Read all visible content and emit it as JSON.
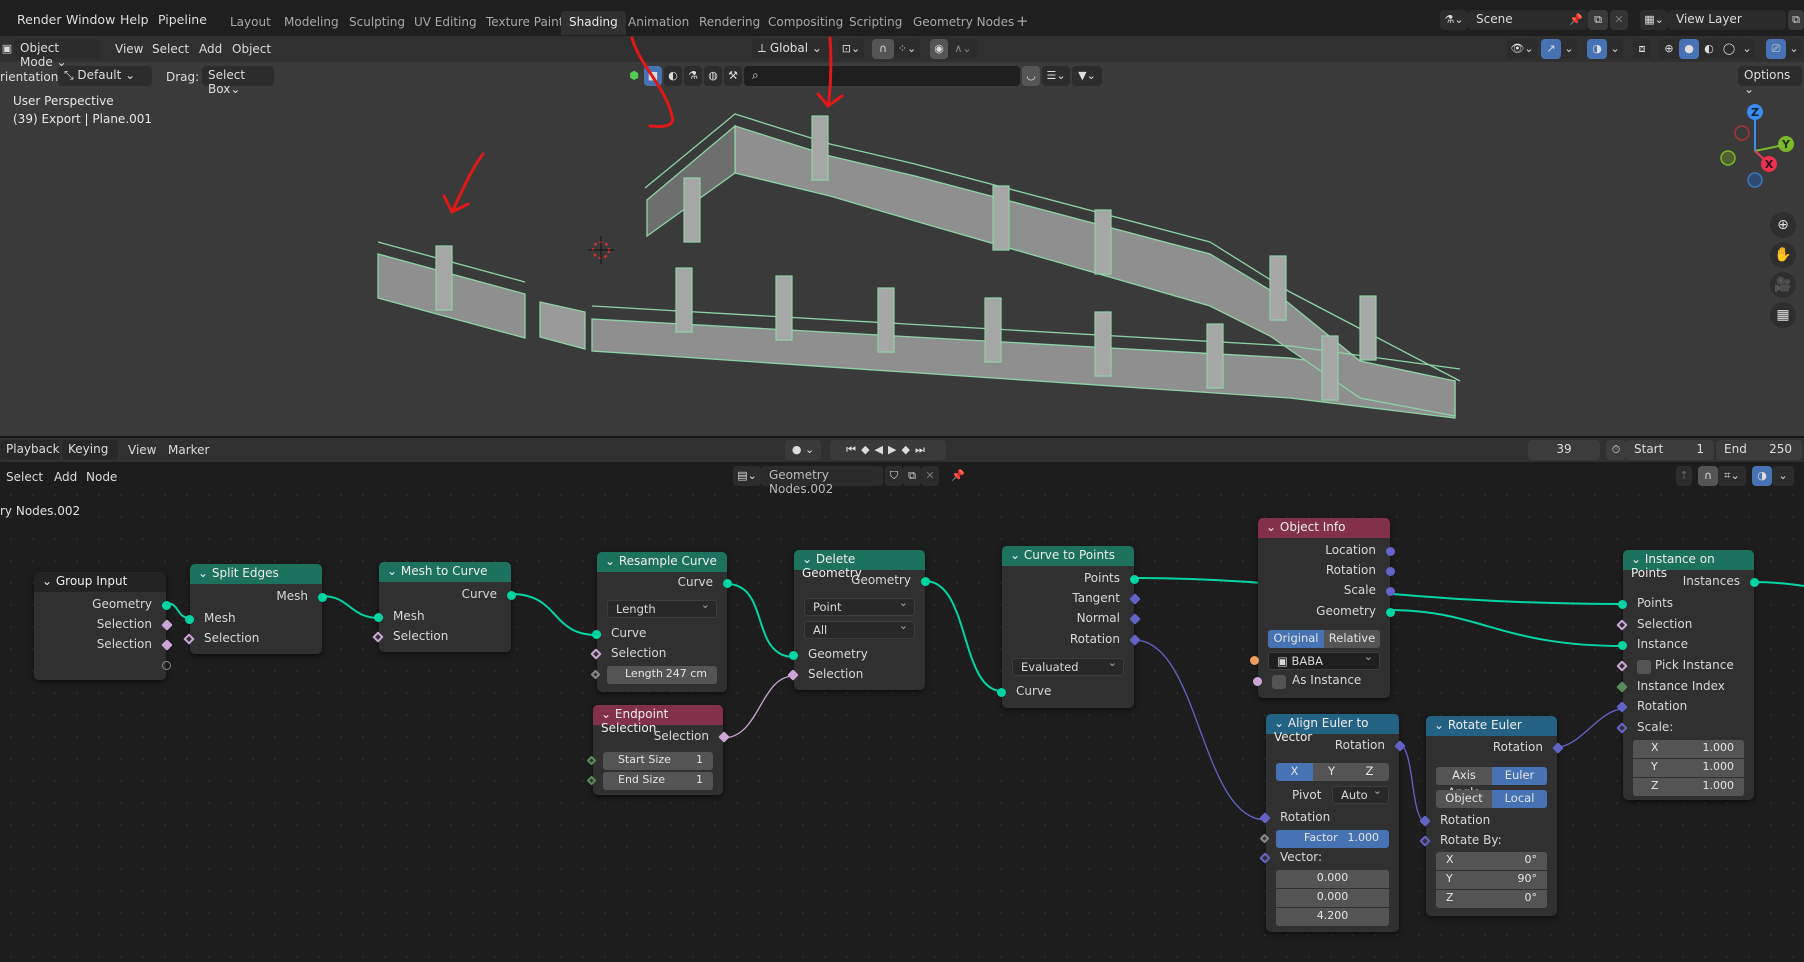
{
  "menubar": {
    "menus": [
      "Render",
      "Window",
      "Help",
      "Pipeline"
    ],
    "workspaces": [
      "Layout",
      "Modeling",
      "Sculpting",
      "UV Editing",
      "Texture Paint",
      "Shading",
      "Animation",
      "Rendering",
      "Compositing",
      "Scripting",
      "Geometry Nodes"
    ],
    "active_workspace": "Shading",
    "add_workspace": "+",
    "scene": "Scene",
    "view_layer": "View Layer"
  },
  "viewport_header": {
    "mode": "Object Mode",
    "menus": [
      "View",
      "Select",
      "Add",
      "Object"
    ],
    "transform_orientation": "Global",
    "orientation_label": "rientation:",
    "orientation_value": "Default",
    "drag_label": "Drag:",
    "drag_value": "Select Box",
    "options": "Options"
  },
  "viewport": {
    "view_name": "User Perspective",
    "object_info": "(39) Export | Plane.001",
    "gizmo_axes": [
      "Z",
      "Y",
      "X"
    ]
  },
  "timeline": {
    "menus": [
      "Playback",
      "Keying",
      "View",
      "Marker"
    ],
    "current_frame": "39",
    "start_label": "Start",
    "start": "1",
    "end_label": "End",
    "end": "250"
  },
  "node_editor": {
    "menus": [
      "Select",
      "Add",
      "Node"
    ],
    "node_tree": "Geometry Nodes.002",
    "breadcrumb": "ry Nodes.002",
    "nodes": {
      "group_input": {
        "title": "Group Input",
        "outputs": [
          "Geometry",
          "Selection",
          "Selection"
        ]
      },
      "split_edges": {
        "title": "Split Edges",
        "output": "Mesh",
        "inputs": [
          "Mesh",
          "Selection"
        ]
      },
      "mesh_to_curve": {
        "title": "Mesh to Curve",
        "output": "Curve",
        "inputs": [
          "Mesh",
          "Selection"
        ]
      },
      "resample_curve": {
        "title": "Resample Curve",
        "output": "Curve",
        "mode": "Length",
        "inputs": [
          "Curve",
          "Selection"
        ],
        "length_label": "Length",
        "length_value": "247 cm"
      },
      "endpoint_selection": {
        "title": "Endpoint Selection",
        "output": "Selection",
        "start_label": "Start Size",
        "start_value": "1",
        "end_label": "End Size",
        "end_value": "1"
      },
      "delete_geometry": {
        "title": "Delete Geometry",
        "output": "Geometry",
        "domain": "Point",
        "mode": "All",
        "inputs": [
          "Geometry",
          "Selection"
        ]
      },
      "curve_to_points": {
        "title": "Curve to Points",
        "outputs": [
          "Points",
          "Tangent",
          "Normal",
          "Rotation"
        ],
        "mode": "Evaluated",
        "input": "Curve"
      },
      "object_info": {
        "title": "Object Info",
        "outputs": [
          "Location",
          "Rotation",
          "Scale",
          "Geometry"
        ],
        "toggle": [
          "Original",
          "Relative"
        ],
        "active_toggle": "Original",
        "object": "BABA",
        "as_instance": "As Instance"
      },
      "align_euler": {
        "title": "Align Euler to Vector",
        "output": "Rotation",
        "axes": [
          "X",
          "Y",
          "Z"
        ],
        "active_axis": "X",
        "pivot_label": "Pivot",
        "pivot_value": "Auto",
        "rotation_label": "Rotation",
        "factor_label": "Factor",
        "factor_value": "1.000",
        "vector_label": "Vector:",
        "vector": [
          "0.000",
          "0.000",
          "4.200"
        ]
      },
      "rotate_euler": {
        "title": "Rotate Euler",
        "output": "Rotation",
        "type_toggle": [
          "Axis Angle",
          "Euler"
        ],
        "space_toggle": [
          "Object",
          "Local"
        ],
        "rotation_label": "Rotation",
        "rotate_by_label": "Rotate By:",
        "rotate_by": [
          {
            "axis": "X",
            "value": "0°"
          },
          {
            "axis": "Y",
            "value": "90°"
          },
          {
            "axis": "Z",
            "value": "0°"
          }
        ]
      },
      "instance_on_points": {
        "title": "Instance on Points",
        "output": "Instances",
        "inputs": [
          "Points",
          "Selection",
          "Instance",
          "Pick Instance",
          "Instance Index",
          "Rotation",
          "Scale:"
        ],
        "scale": [
          {
            "axis": "X",
            "value": "1.000"
          },
          {
            "axis": "Y",
            "value": "1.000"
          },
          {
            "axis": "Z",
            "value": "1.000"
          }
        ]
      }
    }
  },
  "colors": {
    "geometry_node_header": "#1d725e",
    "input_node_header": "#83314a",
    "vector_node_header": "#246283",
    "geometry_socket": "#00d6a3",
    "vector_socket": "#6363c7",
    "boolean_socket": "#cca6d6",
    "accent_blue": "#4772b3",
    "annotation_red": "#e01818"
  }
}
